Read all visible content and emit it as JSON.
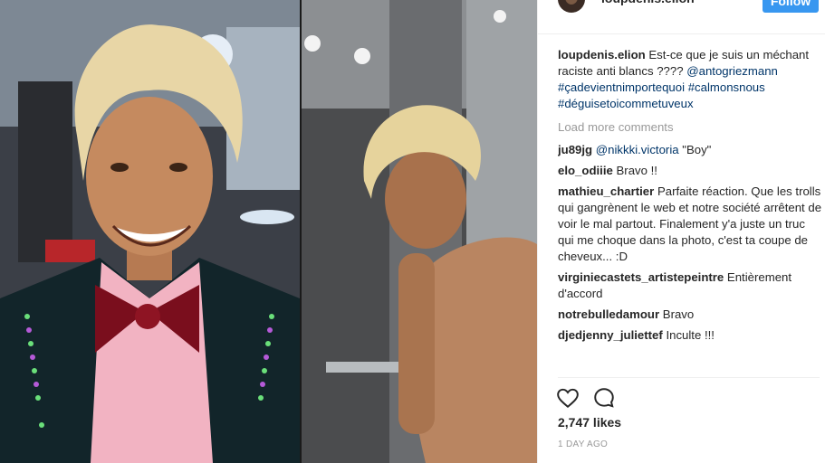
{
  "post": {
    "username": "loupdenis.elion",
    "follow_label": "Follow",
    "caption_text": "Est-ce que je suis un méchant raciste anti blancs ????",
    "hashtags": [
      "@antogriezmann",
      "#çadevientnimportequoi",
      "#calmonsnous",
      "#déguisetoicommetuveux"
    ],
    "load_more": "Load more comments",
    "likes": "2,747 likes",
    "time": "1 DAY AGO"
  },
  "comments": [
    {
      "user": "ju89jg",
      "mention": "@nikkki.victoria",
      "text": "\"Boy\""
    },
    {
      "user": "elo_odiiie",
      "text": "Bravo !!"
    },
    {
      "user": "mathieu_chartier",
      "text": "Parfaite réaction. Que les trolls qui gangrènent le web et notre société arrêtent de voir le mal partout. Finalement y'a juste un truc qui me choque dans la photo, c'est ta coupe de cheveux... :D"
    },
    {
      "user": "virginiecastets_artistepeintre",
      "text": "Entièrement d'accord"
    },
    {
      "user": "notrebulledamour",
      "text": "Bravo"
    },
    {
      "user": "djedjenny_juliettef",
      "text": "Inculte !!!"
    }
  ],
  "icons": {
    "like": "heart-icon",
    "comment": "comment-bubble-icon"
  },
  "colors": {
    "accent": "#3897f0",
    "hashtag": "#003569",
    "muted": "#999999"
  }
}
